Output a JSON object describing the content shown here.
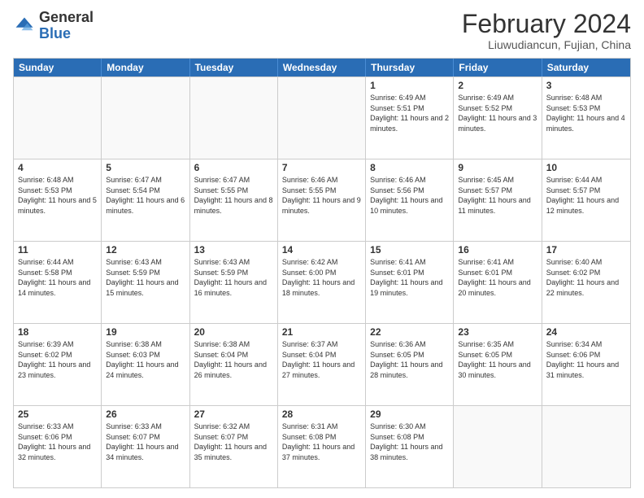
{
  "logo": {
    "general": "General",
    "blue": "Blue"
  },
  "title": {
    "month_year": "February 2024",
    "location": "Liuwudiancun, Fujian, China"
  },
  "days_of_week": [
    "Sunday",
    "Monday",
    "Tuesday",
    "Wednesday",
    "Thursday",
    "Friday",
    "Saturday"
  ],
  "weeks": [
    [
      {
        "day": "",
        "empty": true
      },
      {
        "day": "",
        "empty": true
      },
      {
        "day": "",
        "empty": true
      },
      {
        "day": "",
        "empty": true
      },
      {
        "day": "1",
        "sunrise": "6:49 AM",
        "sunset": "5:51 PM",
        "daylight": "11 hours and 2 minutes."
      },
      {
        "day": "2",
        "sunrise": "6:49 AM",
        "sunset": "5:52 PM",
        "daylight": "11 hours and 3 minutes."
      },
      {
        "day": "3",
        "sunrise": "6:48 AM",
        "sunset": "5:53 PM",
        "daylight": "11 hours and 4 minutes."
      }
    ],
    [
      {
        "day": "4",
        "sunrise": "6:48 AM",
        "sunset": "5:53 PM",
        "daylight": "11 hours and 5 minutes."
      },
      {
        "day": "5",
        "sunrise": "6:47 AM",
        "sunset": "5:54 PM",
        "daylight": "11 hours and 6 minutes."
      },
      {
        "day": "6",
        "sunrise": "6:47 AM",
        "sunset": "5:55 PM",
        "daylight": "11 hours and 8 minutes."
      },
      {
        "day": "7",
        "sunrise": "6:46 AM",
        "sunset": "5:55 PM",
        "daylight": "11 hours and 9 minutes."
      },
      {
        "day": "8",
        "sunrise": "6:46 AM",
        "sunset": "5:56 PM",
        "daylight": "11 hours and 10 minutes."
      },
      {
        "day": "9",
        "sunrise": "6:45 AM",
        "sunset": "5:57 PM",
        "daylight": "11 hours and 11 minutes."
      },
      {
        "day": "10",
        "sunrise": "6:44 AM",
        "sunset": "5:57 PM",
        "daylight": "11 hours and 12 minutes."
      }
    ],
    [
      {
        "day": "11",
        "sunrise": "6:44 AM",
        "sunset": "5:58 PM",
        "daylight": "11 hours and 14 minutes."
      },
      {
        "day": "12",
        "sunrise": "6:43 AM",
        "sunset": "5:59 PM",
        "daylight": "11 hours and 15 minutes."
      },
      {
        "day": "13",
        "sunrise": "6:43 AM",
        "sunset": "5:59 PM",
        "daylight": "11 hours and 16 minutes."
      },
      {
        "day": "14",
        "sunrise": "6:42 AM",
        "sunset": "6:00 PM",
        "daylight": "11 hours and 18 minutes."
      },
      {
        "day": "15",
        "sunrise": "6:41 AM",
        "sunset": "6:01 PM",
        "daylight": "11 hours and 19 minutes."
      },
      {
        "day": "16",
        "sunrise": "6:41 AM",
        "sunset": "6:01 PM",
        "daylight": "11 hours and 20 minutes."
      },
      {
        "day": "17",
        "sunrise": "6:40 AM",
        "sunset": "6:02 PM",
        "daylight": "11 hours and 22 minutes."
      }
    ],
    [
      {
        "day": "18",
        "sunrise": "6:39 AM",
        "sunset": "6:02 PM",
        "daylight": "11 hours and 23 minutes."
      },
      {
        "day": "19",
        "sunrise": "6:38 AM",
        "sunset": "6:03 PM",
        "daylight": "11 hours and 24 minutes."
      },
      {
        "day": "20",
        "sunrise": "6:38 AM",
        "sunset": "6:04 PM",
        "daylight": "11 hours and 26 minutes."
      },
      {
        "day": "21",
        "sunrise": "6:37 AM",
        "sunset": "6:04 PM",
        "daylight": "11 hours and 27 minutes."
      },
      {
        "day": "22",
        "sunrise": "6:36 AM",
        "sunset": "6:05 PM",
        "daylight": "11 hours and 28 minutes."
      },
      {
        "day": "23",
        "sunrise": "6:35 AM",
        "sunset": "6:05 PM",
        "daylight": "11 hours and 30 minutes."
      },
      {
        "day": "24",
        "sunrise": "6:34 AM",
        "sunset": "6:06 PM",
        "daylight": "11 hours and 31 minutes."
      }
    ],
    [
      {
        "day": "25",
        "sunrise": "6:33 AM",
        "sunset": "6:06 PM",
        "daylight": "11 hours and 32 minutes."
      },
      {
        "day": "26",
        "sunrise": "6:33 AM",
        "sunset": "6:07 PM",
        "daylight": "11 hours and 34 minutes."
      },
      {
        "day": "27",
        "sunrise": "6:32 AM",
        "sunset": "6:07 PM",
        "daylight": "11 hours and 35 minutes."
      },
      {
        "day": "28",
        "sunrise": "6:31 AM",
        "sunset": "6:08 PM",
        "daylight": "11 hours and 37 minutes."
      },
      {
        "day": "29",
        "sunrise": "6:30 AM",
        "sunset": "6:08 PM",
        "daylight": "11 hours and 38 minutes."
      },
      {
        "day": "",
        "empty": true
      },
      {
        "day": "",
        "empty": true
      }
    ]
  ]
}
